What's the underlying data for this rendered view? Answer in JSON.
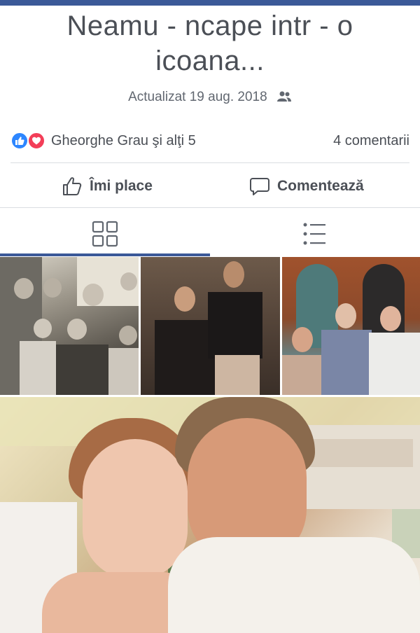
{
  "post": {
    "title": "Neamu - ncape intr - o icoana...",
    "updated": "Actualizat 19 aug. 2018",
    "privacy_icon": "friends-icon"
  },
  "reactions": {
    "types": [
      "like",
      "love"
    ],
    "colors": {
      "like": "#2d86ff",
      "love": "#f33e58"
    },
    "people": "Gheorghe Grau şi alţi 5",
    "comments": "4 comentarii"
  },
  "actions": {
    "like_label": "Îmi place",
    "comment_label": "Comentează"
  },
  "view_tabs": {
    "items": [
      {
        "icon": "grid-view-icon",
        "active": true
      },
      {
        "icon": "list-view-icon",
        "active": false
      }
    ],
    "accent": "#3b5998"
  },
  "photos": [
    {
      "name": "family-group-photo"
    },
    {
      "name": "couple-vintage-photo"
    },
    {
      "name": "three-women-photo"
    },
    {
      "name": "selfie-photo"
    }
  ]
}
